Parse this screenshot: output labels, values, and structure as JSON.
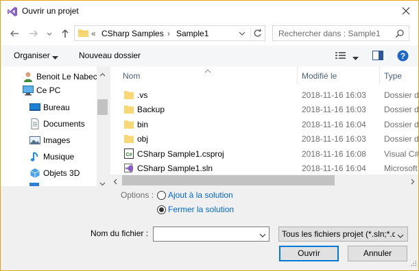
{
  "title": "Ouvrir un projet",
  "nav": {
    "path_prefix": "«",
    "path": [
      "CSharp Samples",
      "Sample1"
    ],
    "path_separator": "›",
    "search_placeholder": "Rechercher dans : Sample1"
  },
  "toolbar": {
    "organize_label": "Organiser",
    "new_folder_label": "Nouveau dossier"
  },
  "tree": [
    {
      "label": "Benoit Le Nabec",
      "icon": "user-icon"
    },
    {
      "label": "Ce PC",
      "icon": "computer-icon"
    },
    {
      "label": "Bureau",
      "icon": "desktop-icon"
    },
    {
      "label": "Documents",
      "icon": "documents-icon"
    },
    {
      "label": "Images",
      "icon": "pictures-icon"
    },
    {
      "label": "Musique",
      "icon": "music-icon"
    },
    {
      "label": "Objets 3D",
      "icon": "3d-objects-icon"
    }
  ],
  "columns": {
    "name": "Nom",
    "modified": "Modifié le",
    "type": "Type"
  },
  "files": [
    {
      "name": ".vs",
      "modified": "2018-11-16 16:03",
      "type": "Dossier de fichiers",
      "icon": "folder-icon"
    },
    {
      "name": "Backup",
      "modified": "2018-11-16 16:03",
      "type": "Dossier de fichiers",
      "icon": "folder-icon"
    },
    {
      "name": "bin",
      "modified": "2018-11-16 16:04",
      "type": "Dossier de fichiers",
      "icon": "folder-icon"
    },
    {
      "name": "obj",
      "modified": "2018-11-16 16:03",
      "type": "Dossier de fichiers",
      "icon": "folder-icon"
    },
    {
      "name": "CSharp Sample1.csproj",
      "modified": "2018-11-16 16:08",
      "type": "Visual C# Project file",
      "icon": "csproj-icon"
    },
    {
      "name": "CSharp Sample1.sln",
      "modified": "2018-11-16 16:04",
      "type": "Microsoft Visual Studio Solution",
      "icon": "sln-icon"
    }
  ],
  "options": {
    "label": "Options :",
    "radio_add": "Ajout à la solution",
    "radio_close": "Fermer la solution",
    "selected": "radio_close"
  },
  "footer": {
    "filename_label": "Nom du fichier :",
    "filename_value": "",
    "filter_value": "Tous les fichiers projet (*.sln;*.d",
    "open_label": "Ouvrir",
    "cancel_label": "Annuler"
  },
  "colors": {
    "accent": "#0078d7",
    "link": "#0066cc",
    "folder": "#f8d775",
    "vs_purple": "#865fc5",
    "border_frame": "#e3a21a"
  }
}
